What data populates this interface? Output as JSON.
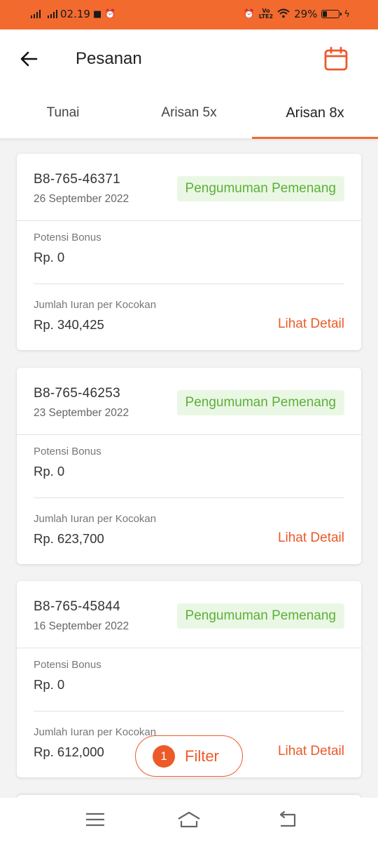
{
  "status_bar": {
    "time": "02.19",
    "battery_percent": "29%",
    "battery_level": 0.29,
    "network_label": "LTE2"
  },
  "header": {
    "title": "Pesanan",
    "back_icon": "arrow-left-icon",
    "calendar_icon": "calendar-icon"
  },
  "tabs": [
    {
      "label": "Tunai",
      "active": false
    },
    {
      "label": "Arisan 5x",
      "active": false
    },
    {
      "label": "Arisan 8x",
      "active": true
    }
  ],
  "orders": [
    {
      "id": "B8-765-46371",
      "date": "26 September 2022",
      "status": "Pengumuman Pemenang",
      "bonus_label": "Potensi Bonus",
      "bonus_value": "Rp. 0",
      "iuran_label": "Jumlah Iuran per Kocokan",
      "iuran_value": "Rp. 340,425",
      "detail_label": "Lihat Detail"
    },
    {
      "id": "B8-765-46253",
      "date": "23 September 2022",
      "status": "Pengumuman Pemenang",
      "bonus_label": "Potensi Bonus",
      "bonus_value": "Rp. 0",
      "iuran_label": "Jumlah Iuran per Kocokan",
      "iuran_value": "Rp. 623,700",
      "detail_label": "Lihat Detail"
    },
    {
      "id": "B8-765-45844",
      "date": "16 September 2022",
      "status": "Pengumuman Pemenang",
      "bonus_label": "Potensi Bonus",
      "bonus_value": "Rp. 0",
      "iuran_label": "Jumlah Iuran per Kocokan",
      "iuran_value": "Rp. 612,000",
      "detail_label": "Lihat Detail"
    }
  ],
  "filter": {
    "count": "1",
    "label": "Filter"
  },
  "navbar": {
    "icons": [
      "menu-icon",
      "home-icon",
      "back-icon"
    ]
  },
  "colors": {
    "accent": "#f26a2e",
    "link": "#ec5a2a",
    "badge_bg": "#eaf7e4",
    "badge_text": "#5cb03a"
  }
}
